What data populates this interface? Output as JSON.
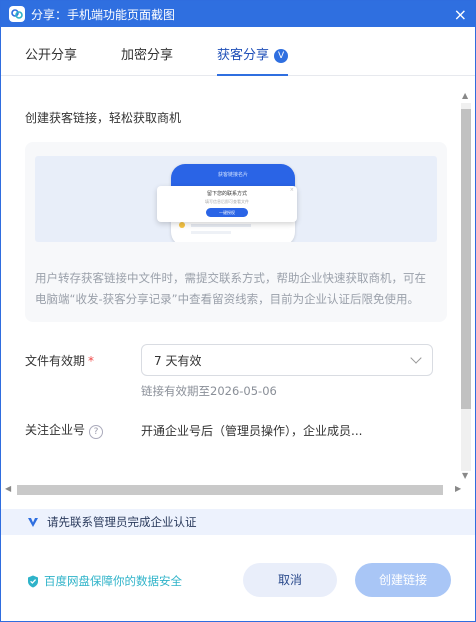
{
  "window": {
    "title": "分享：手机端功能页面截图",
    "close_glyph": "×"
  },
  "tabs": [
    {
      "label": "公开分享",
      "active": false
    },
    {
      "label": "加密分享",
      "active": false
    },
    {
      "label": "获客分享",
      "active": true,
      "badge": "V"
    }
  ],
  "main": {
    "headline": "创建获客链接，轻松获取商机",
    "illustration": {
      "phone_header": "获客链接名片",
      "dialog_title": "留下您的联系方式",
      "dialog_sub": "填写信息后即可查看文件",
      "dialog_button": "一键授权",
      "dialog_close": "×"
    },
    "description": "用户转存获客链接中文件时，需提交联系方式，帮助企业快速获取商机，可在电脑端“收发-获客分享记录”中查看留资线索，目前为企业认证后限免使用。"
  },
  "form": {
    "validity_label": "文件有效期",
    "validity_required": "*",
    "validity_value": "7 天有效",
    "validity_hint": "链接有效期至2026-05-06",
    "enterprise_label": "关注企业号",
    "enterprise_help": "?",
    "enterprise_value": "开通企业号后（管理员操作），企业成员..."
  },
  "notice": {
    "text": "请先联系管理员完成企业认证"
  },
  "footer": {
    "security_text": "百度网盘保障你的数据安全",
    "cancel_label": "取消",
    "create_label": "创建链接"
  },
  "colors": {
    "accent": "#2f6fe0",
    "required": "#f04848",
    "security": "#2fb3c9"
  }
}
